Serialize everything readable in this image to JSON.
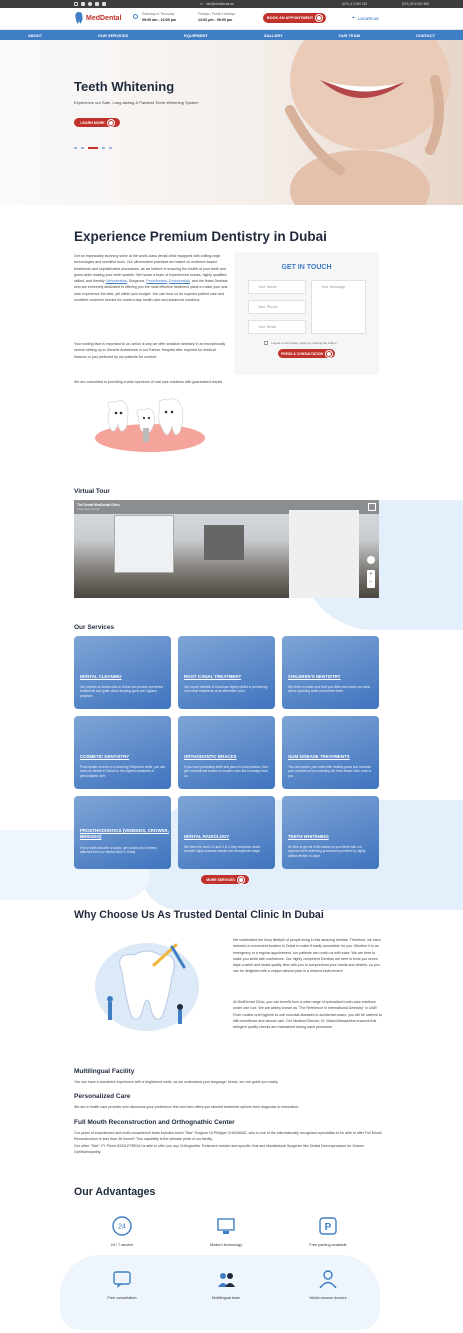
{
  "topbar": {
    "email": "info@meddental.ae",
    "phone1": "(971) 4 3 000 210",
    "phone2": "(971) 55 6 961 555"
  },
  "header": {
    "logo_text": "MedDental",
    "hours1_label": "Saturday to Thursday",
    "hours1_value": "09:00 am - 10:00 pm",
    "hours2_label": "Fridays / Public Holidays",
    "hours2_value": "12:00 pm - 09:00 pm",
    "book_label": "BOOK AN APPOINTMENT",
    "locate_label": "LOCATE US"
  },
  "nav": [
    "ABOUT",
    "OUR SERVICES",
    "EQUIPMENT",
    "GALLERY",
    "OUR TEAM",
    "CONTACT"
  ],
  "hero": {
    "title": "Teeth Whitening",
    "subtitle": "Experience our Safe, Long-lasting & Painless Teeth Whitening System",
    "cta": "LEARN MORE"
  },
  "intro": {
    "title": "Experience Premium Dentistry in Dubai",
    "p1_a": "Get an impeccably stunning smile at the world-class dental clinic equipped with cutting-edge technologies and sensitive tools. Our ultramodern practices are based on evidence-based treatments and sophisticated procedures, as we believe in ensuring the health of your teeth and gums while making your teeth sparkle. We house a team of experienced nurses, highly qualified, skilled, and friendly ",
    "link1": "Orthodontists",
    "sep1": ", Surgeons, ",
    "link2": "Periodontists",
    "sep2": ", ",
    "link3": "Endodontists",
    "p1_b": ", and the finest Dentists who are extremely dedicated to offering you the most effective treatment plans to make your oral care experience the best, yet within your budget. You can trust us for superior patient care and excellent customer service for modern-day health care and advanced solutions.",
    "p2": "Your smiling face is important to us, which is why we offer sedation dentistry in an exceptionally serene setting up to General Anesthesia in our Partner Hospital after required for medical reasons or just preferred by our patients for comfort.",
    "p3": "We are committed to providing a wide spectrum of oral care solutions with guaranteed results."
  },
  "contact_form": {
    "title": "GET IN TOUCH",
    "name_placeholder": "Your Name",
    "phone_placeholder": "Your Phone",
    "email_placeholder": "Your Email",
    "message_placeholder": "Your Message",
    "consent": "I agree to the privacy policy by clicking the button",
    "submit": "PRESS & CONSULTATION"
  },
  "tour": {
    "title": "Virtual Tour",
    "label": "The Dental MedDental Clinic",
    "sublabel": "powered by Google"
  },
  "services": {
    "title": "Our Services",
    "items": [
      {
        "title": "DENTAL CLEANING",
        "desc": "Our experts at dental clinic in Dubai can provide preventive treatments and guide about keeping good oral hygiene practices."
      },
      {
        "title": "ROOT CANAL TREATMENT",
        "desc": "Our expert dentists in Dubai are highly skilled in performing root canal treatments at an affordable price."
      },
      {
        "title": "CHILDREN'S DENTISTRY",
        "desc": "We strive to make sure that your little one leaves our clinic with a sparkling smile and perfect teeth."
      },
      {
        "title": "COSMETIC DENTISTRY",
        "desc": "From dental veneers to a stunning Hollywood smile, you can trust our dentist in Dubai for the highest standards of personalized care."
      },
      {
        "title": "ORTHODONTIC BRACES",
        "desc": "If you have protruding teeth and jaws in a bad position, then get conventional braces or modern ones like Invisalign from us."
      },
      {
        "title": "GUM DISEASE TREATMENTS",
        "desc": "You can restore your smile with healthy gums and increase your confidence by consulting the best dental Clinic near to you."
      },
      {
        "title": "PROSTHODONTICS (VENEERS, CROWNS, BRIDGES)",
        "desc": "If your teeth become crooked, get crowns and veneers attached from our dental clinic in Dubai."
      },
      {
        "title": "DENTAL RADIOLOGY",
        "desc": "We have the best 2-D and 3-D X-Ray machines which provide highly accurate results and exceptional image."
      },
      {
        "title": "TEETH WHITENING",
        "desc": "It's time to get rid of the stains on your teeth with our superior teeth whitening procedures provided by highly skilled dentist in Dubai."
      }
    ],
    "more": "MORE SERVICES"
  },
  "why": {
    "title": "Why Choose Us As Trusted Dental Clinic In Dubai",
    "p1": "We understand the busy lifestyle of people living in this amazing emirate. Therefore, we have selected a convenient location in Dubai to make it easily accessible for you. Whether it is an emergency or a regular appointment, our patients can reach us with ease. We are here to make you smile with confidence. Our highly competent Dentists are here to treat you seven days a week and invest quality time with you to comprehend your needs and desires, so you can be delighted with a unique tailored plan in a relaxed environment.",
    "p2": "At MedDental Clinic, you can benefit from a wide range of specialized tooth-care solutions under one roof. We are widely known as \"The Reference in International Dentistry\" in UAE! From routine oral hygiene to oral mucosal diseases to accidental cases, you will be catered to with excellence and utmost care. Our Medical Director, Dr. Maria Aleksashina ensures that stringent quality checks are maintained during each procedure."
  },
  "features": [
    {
      "title": "Multilingual Facility",
      "text": "You can have a wonderful experience with a brightened smile, as we understand your language; hence, we can guide you easily."
    },
    {
      "title": "Personalized Care",
      "text": "We are a health care provider who discusses your preference first and then offers you tailored treatment options from diagnosis to restoration."
    },
    {
      "title": "Full Mouth Reconstruction and Orthognathic Center",
      "text": "Our years of experienced and multi-competence team includes world \"Star\" Surgeon Dr.Philippe CHANAVAZ, who is one of the internationally recognized specialists to be able to offer Full Mouth Reconstruction in less than 36 hours!!! This capability is the ultimate pride of our facility.",
      "text2": "Our other \"Star\", Pr. Pierre BOULETREAU is able to offer you any Orthognathic Treatment needed and specific Oral and Maxillofacial Surgeries like Orbital Decompression for Graves Ophthalmopathy."
    }
  ],
  "advantages": {
    "title": "Our Advantages",
    "items": [
      {
        "label": "24 / 7 service",
        "icon": "support-24-icon"
      },
      {
        "label": "Modern technology",
        "icon": "technology-icon"
      },
      {
        "label": "Free parking available",
        "icon": "parking-icon"
      },
      {
        "label": "Free consultation",
        "icon": "consultation-icon"
      },
      {
        "label": "Multilingual team",
        "icon": "team-icon"
      },
      {
        "label": "World-renown doctors",
        "icon": "doctor-icon"
      }
    ]
  },
  "colors": {
    "brand_blue": "#3f7ec4",
    "accent_red": "#c0322b",
    "dark_text": "#1f2a3d"
  }
}
